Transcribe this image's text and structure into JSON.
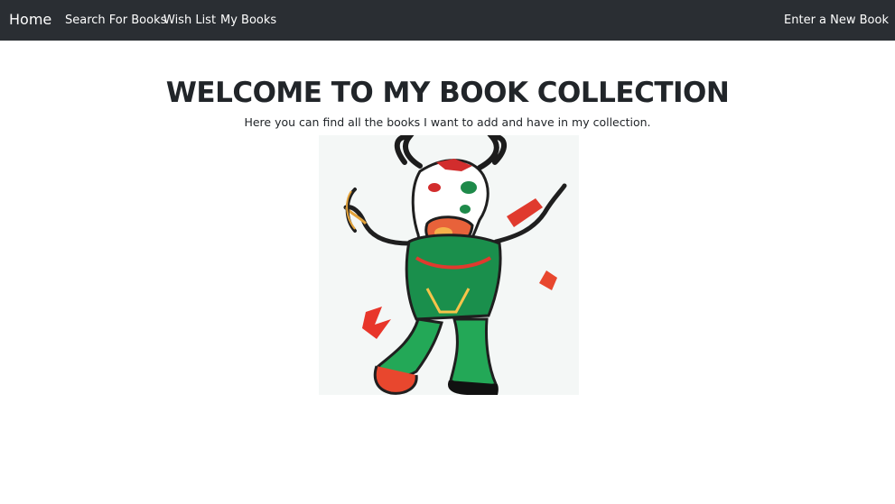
{
  "navbar": {
    "brand": "Home",
    "links": [
      {
        "label": "Search For Books"
      },
      {
        "label": "Wish List"
      },
      {
        "label": "My Books"
      }
    ],
    "right_link": "Enter a New Book",
    "background": "#2a2e33"
  },
  "main": {
    "title": "WELCOME TO MY BOOK COLLECTION",
    "subtitle": "Here you can find all the books I want to add and have in my collection.",
    "image": {
      "icon": "cartoon-bull-illustration",
      "alt": ""
    }
  }
}
